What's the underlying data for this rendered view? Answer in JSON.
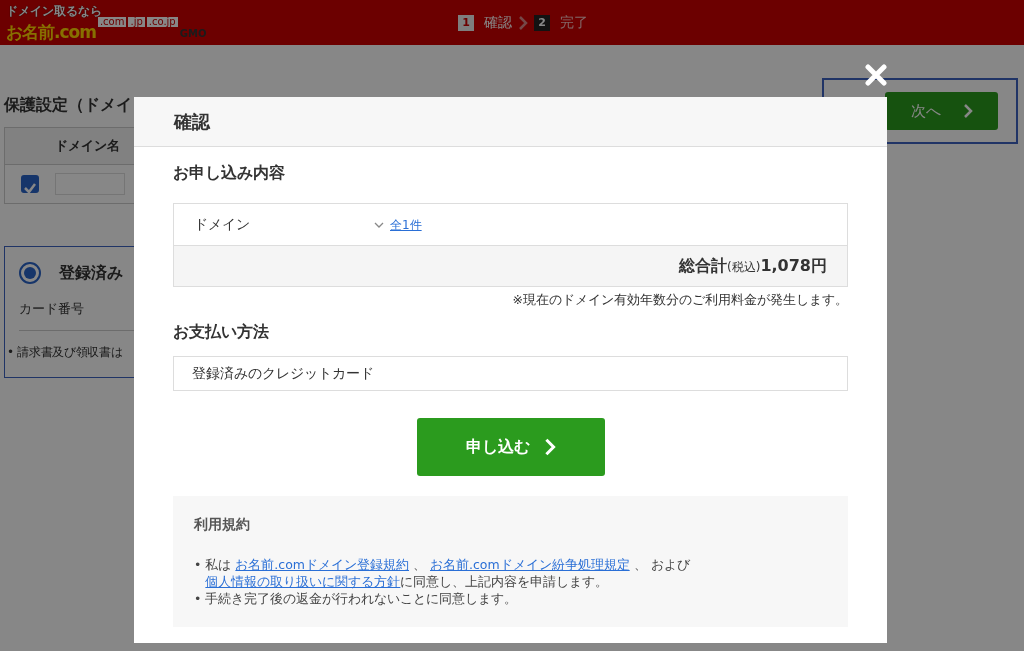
{
  "header": {
    "logo": {
      "tagline": "ドメイン取るなら",
      "name": "お名前.com",
      "tlds": [
        ".com",
        ".jp",
        ".co.jp"
      ],
      "vendor": "GMO"
    },
    "steps": [
      {
        "number": "1",
        "label": "確認",
        "selected": true
      },
      {
        "number": "2",
        "label": "完了",
        "selected": false
      }
    ]
  },
  "page": {
    "heading": "保護設定（ドメイ",
    "table": {
      "column": "ドメイン名",
      "row": {
        "checked": true
      }
    },
    "payment": {
      "option": "登録済み",
      "selected": true,
      "card_label": "カード番号",
      "note": "• 請求書及び領収書は"
    },
    "next_button": "次へ"
  },
  "modal": {
    "title": "確認",
    "order_heading": "お申し込み内容",
    "order_item": {
      "label": "ドメイン",
      "count_link": "全1件"
    },
    "total": {
      "label": "総合計",
      "tax": "(税込)",
      "amount": "1,078円"
    },
    "note": "※現在のドメイン有効年数分のご利用料金が発生します。",
    "payment_heading": "お支払い方法",
    "payment_method": "登録済みのクレジットカード",
    "submit_button": "申し込む",
    "terms": {
      "title": "利用規約",
      "bullet": "•",
      "items": [
        [
          {
            "kind": "text",
            "text": "私は "
          },
          {
            "kind": "link",
            "text": "お名前.comドメイン登録規約"
          },
          {
            "kind": "text",
            "text": " 、 "
          },
          {
            "kind": "link",
            "text": "お名前.comドメイン紛争処理規定"
          },
          {
            "kind": "text",
            "text": " 、 および"
          },
          {
            "kind": "link",
            "text": "個人情報の取り扱いに関する方針"
          },
          {
            "kind": "text",
            "text": "に同意し、上記内容を申請します。"
          }
        ],
        [
          {
            "kind": "text",
            "text": "手続き完了後の返金が行われないことに同意します。"
          }
        ]
      ]
    }
  }
}
